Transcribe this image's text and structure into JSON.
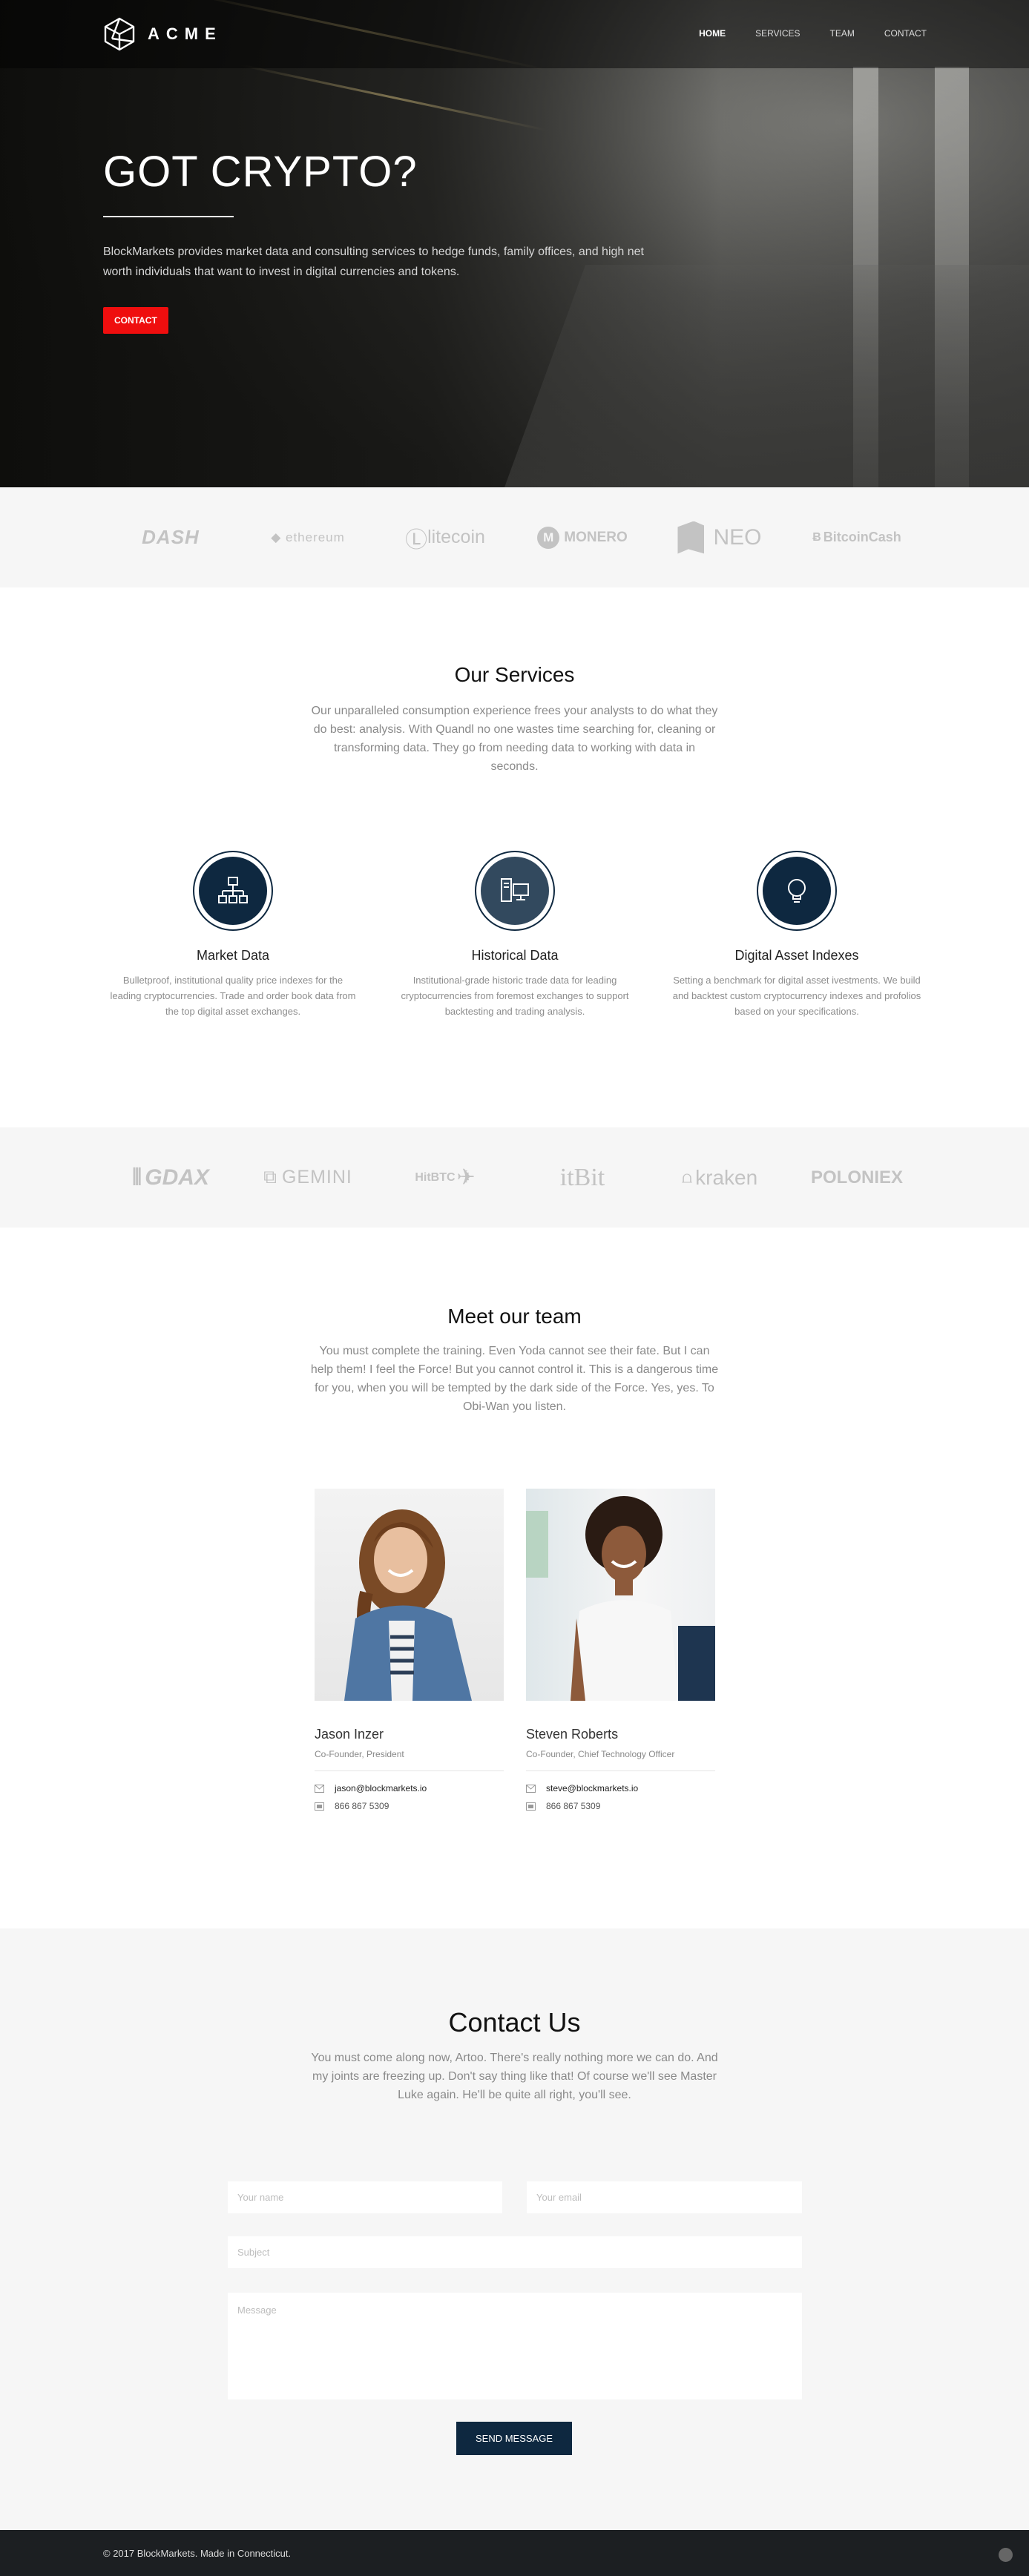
{
  "brand": {
    "name": "ACME",
    "icon": "cube-icon"
  },
  "nav": {
    "items": [
      {
        "label": "HOME",
        "active": true
      },
      {
        "label": "SERVICES",
        "active": false
      },
      {
        "label": "TEAM",
        "active": false
      },
      {
        "label": "CONTACT",
        "active": false
      }
    ]
  },
  "hero": {
    "title": "GOT CRYPTO?",
    "text": "BlockMarkets provides market data and consulting services to hedge funds, family offices, and high net worth individuals that want to invest in digital currencies and tokens.",
    "button": "CONTACT"
  },
  "coins": [
    "DASH",
    "ethereum",
    "litecoin",
    "MONERO",
    "NEO",
    "BitcoinCash"
  ],
  "services": {
    "title": "Our Services",
    "lead": "Our unparalleled consumption experience frees your analysts to do what they do best: analysis. With Quandl no one wastes time searching for, cleaning or transforming data. They go from needing data to working with data in seconds.",
    "items": [
      {
        "icon": "sitemap-icon",
        "title": "Market Data",
        "text": "Bulletproof, institutional quality price indexes for the leading cryptocurrencies. Trade and order book data from the top digital asset exchanges."
      },
      {
        "icon": "computer-icon",
        "title": "Historical Data",
        "text": "Institutional-grade historic trade data for leading cryptocurrencies from foremost exchanges to support backtesting and trading analysis."
      },
      {
        "icon": "lightbulb-icon",
        "title": "Digital Asset Indexes",
        "text": "Setting a benchmark for digital asset ivestments. We build and backtest custom cryptocurrency indexes and profolios based on your specifications."
      }
    ]
  },
  "exchanges": [
    "GDAX",
    "GEMINI",
    "HitBTC",
    "itBit",
    "kraken",
    "POLONIEX"
  ],
  "team": {
    "title": "Meet our team",
    "lead": "You must complete the training. Even Yoda cannot see their fate. But I can help them! I feel the Force! But you cannot control it. This is a dangerous time for you, when you will be tempted by the dark side of the Force. Yes, yes. To Obi-Wan you listen.",
    "members": [
      {
        "name": "Jason Inzer",
        "role": "Co-Founder, President",
        "email": "jason@blockmarkets.io",
        "phone": "866 867 5309"
      },
      {
        "name": "Steven Roberts",
        "role": "Co-Founder, Chief Technology Officer",
        "email": "steve@blockmarkets.io",
        "phone": "866 867 5309"
      }
    ]
  },
  "contact": {
    "title": "Contact Us",
    "lead": "You must come along now, Artoo. There's really nothing more we can do. And my joints are freezing up. Don't say thing like that! Of course we'll see Master Luke again. He'll be quite all right, you'll see.",
    "name_placeholder": "Your name",
    "email_placeholder": "Your email",
    "subject_placeholder": "Subject",
    "message_placeholder": "Message",
    "send_label": "SEND MESSAGE"
  },
  "footer": {
    "text": "© 2017 BlockMarkets. Made in Connecticut."
  },
  "colors": {
    "accent": "#ef0e0e",
    "navy": "#0e2840",
    "footer": "#1c1f22"
  }
}
